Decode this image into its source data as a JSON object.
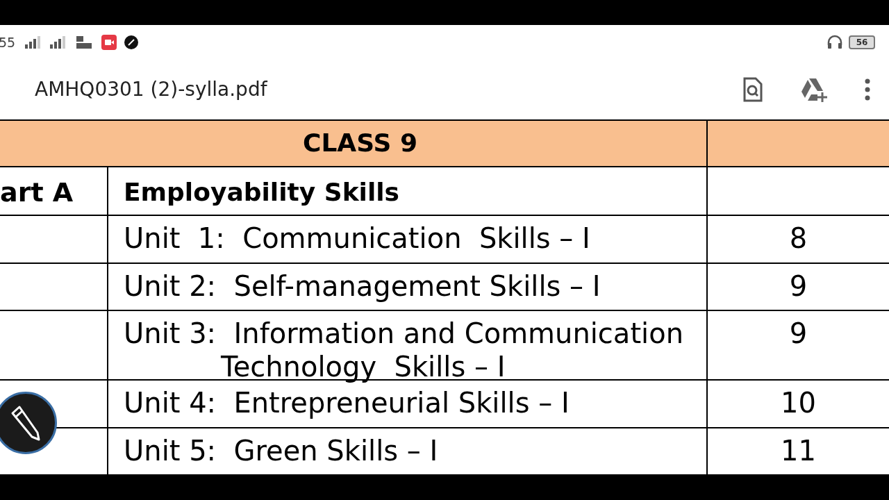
{
  "status_bar": {
    "time": "55",
    "battery": "56"
  },
  "app_bar": {
    "title": "AMHQ0301 (2)-sylla.pdf"
  },
  "table": {
    "header": "CLASS 9",
    "rows": [
      {
        "kind": "section",
        "column_1": "art A",
        "unit": "Employability Skills",
        "column_3": ""
      },
      {
        "kind": "unit",
        "unit": "Unit  1:  Communication  Skills – I",
        "column_3": "8"
      },
      {
        "kind": "unit",
        "unit": "Unit 2:  Self-management Skills – I",
        "column_3": "9"
      },
      {
        "kind": "unit",
        "unit": "Unit 3:  Information and Communication",
        "continuation": "Technology  Skills – I",
        "column_3": "9"
      },
      {
        "kind": "unit",
        "unit": "Unit 4:  Entrepreneurial Skills – I",
        "column_3": "10"
      },
      {
        "kind": "unit",
        "unit": "Unit 5:  Green Skills – I",
        "column_3": "11"
      }
    ]
  }
}
